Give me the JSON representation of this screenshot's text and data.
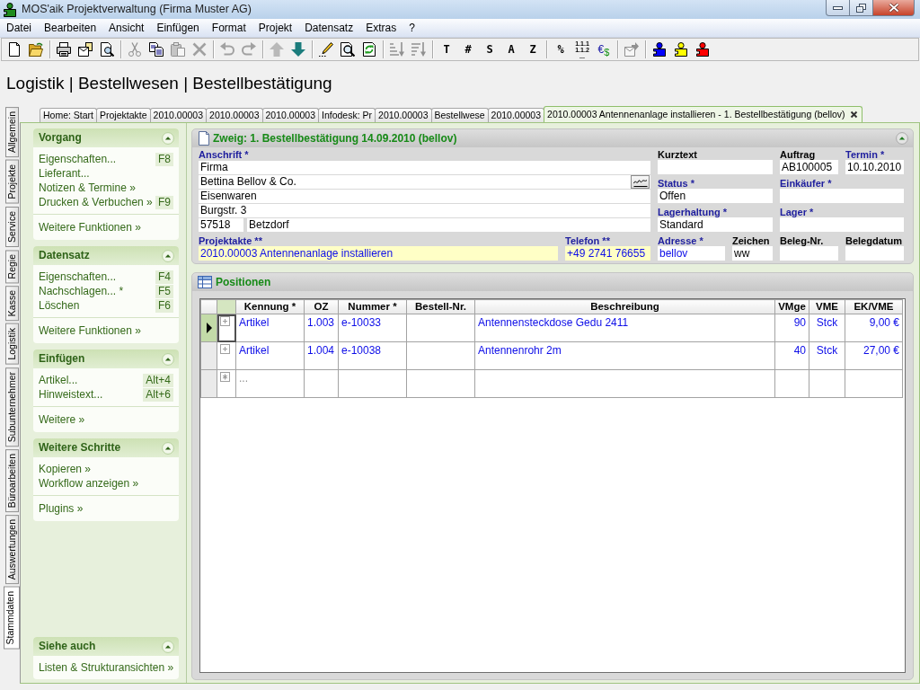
{
  "window": {
    "title": "MOS'aik Projektverwaltung (Firma Muster AG)"
  },
  "menu": [
    "Datei",
    "Bearbeiten",
    "Ansicht",
    "Einfügen",
    "Format",
    "Projekt",
    "Datensatz",
    "Extras",
    "?"
  ],
  "toolbar": [
    [
      {
        "kind": "icon",
        "disabled": false
      },
      {
        "kind": "icon",
        "disabled": false
      }
    ],
    [
      {
        "kind": "icon",
        "disabled": false
      },
      {
        "kind": "icon",
        "disabled": false
      },
      {
        "kind": "icon",
        "disabled": false
      }
    ],
    [
      {
        "kind": "icon",
        "disabled": true
      },
      {
        "kind": "icon",
        "disabled": false
      },
      {
        "kind": "icon",
        "disabled": true
      },
      {
        "kind": "icon",
        "disabled": true
      }
    ],
    [
      {
        "kind": "icon",
        "disabled": true
      },
      {
        "kind": "icon",
        "disabled": true
      }
    ],
    [
      {
        "kind": "icon",
        "disabled": true
      },
      {
        "kind": "icon",
        "disabled": false
      }
    ],
    [
      {
        "kind": "icon",
        "disabled": false
      },
      {
        "kind": "icon",
        "disabled": false
      },
      {
        "kind": "icon",
        "disabled": false
      }
    ],
    [
      {
        "kind": "icon",
        "disabled": true
      },
      {
        "kind": "icon",
        "disabled": true
      }
    ],
    [
      {
        "kind": "text",
        "label": "T"
      },
      {
        "kind": "text",
        "label": "#"
      },
      {
        "kind": "text",
        "label": "S"
      },
      {
        "kind": "text",
        "label": "A"
      },
      {
        "kind": "text",
        "label": "Z"
      }
    ],
    [
      {
        "kind": "text",
        "label": "%"
      },
      {
        "kind": "outline",
        "lines": [
          "1.1.1",
          "1.1.2",
          "..."
        ]
      },
      {
        "kind": "currency",
        "label": "€",
        "suffix": "$"
      }
    ],
    [
      {
        "kind": "icon",
        "disabled": true
      }
    ],
    [
      {
        "kind": "puzzle",
        "color": "#0000ff"
      },
      {
        "kind": "puzzle",
        "color": "#ffff00"
      },
      {
        "kind": "puzzle",
        "color": "#ff0000"
      }
    ]
  ],
  "page_title": "Logistik | Bestellwesen | Bestellbestätigung",
  "document_tabs": [
    {
      "label": "Home: Start",
      "selected": false
    },
    {
      "label": "Projektakte",
      "selected": false
    },
    {
      "label": "2010.00003",
      "selected": false
    },
    {
      "label": "2010.00003",
      "selected": false
    },
    {
      "label": "2010.00003",
      "selected": false
    },
    {
      "label": "Infodesk: Pr",
      "selected": false
    },
    {
      "label": "2010.00003",
      "selected": false
    },
    {
      "label": "Bestellwese",
      "selected": false
    },
    {
      "label": "2010.00003",
      "selected": false
    },
    {
      "label": "2010.00003 Antennenanlage installieren - 1. Bestellbestätigung (bellov)",
      "selected": true
    }
  ],
  "side_tabs": [
    {
      "label": "Allgemein",
      "selected": false
    },
    {
      "label": "Projekte",
      "selected": false
    },
    {
      "label": "Service",
      "selected": false
    },
    {
      "label": "Regie",
      "selected": false
    },
    {
      "label": "Kasse",
      "selected": false
    },
    {
      "label": "Logistik",
      "selected": false
    },
    {
      "label": "Subunternehmer",
      "selected": false
    },
    {
      "label": "Büroarbeiten",
      "selected": false
    },
    {
      "label": "Auswertungen",
      "selected": false
    },
    {
      "label": "Stammdaten",
      "selected": true
    }
  ],
  "sidebar": {
    "sections": [
      {
        "title": "Vorgang",
        "expanded": true,
        "items": [
          {
            "label": "Eigenschaften...",
            "shortcut": "F8"
          },
          {
            "label": "Lieferant..."
          },
          {
            "label": "Notizen & Termine »"
          },
          {
            "label": "Drucken & Verbuchen »",
            "shortcut": "F9"
          }
        ],
        "footer": "Weitere Funktionen »"
      },
      {
        "title": "Datensatz",
        "expanded": true,
        "items": [
          {
            "label": "Eigenschaften...",
            "shortcut": "F4"
          },
          {
            "label": "Nachschlagen... *",
            "shortcut": "F5"
          },
          {
            "label": "Löschen",
            "shortcut": "F6"
          }
        ],
        "footer": "Weitere Funktionen »"
      },
      {
        "title": "Einfügen",
        "expanded": true,
        "items": [
          {
            "label": "Artikel...",
            "shortcut": "Alt+4"
          },
          {
            "label": "Hinweistext...",
            "shortcut": "Alt+6"
          }
        ],
        "footer": "Weitere »"
      },
      {
        "title": "Weitere Schritte",
        "expanded": true,
        "items": [
          {
            "label": "Kopieren »"
          },
          {
            "label": "Workflow anzeigen »"
          }
        ],
        "footer": "Plugins »"
      }
    ],
    "bottom_section": {
      "title": "Siehe auch",
      "expanded": true,
      "items": [
        {
          "label": "Listen & Strukturansichten »"
        }
      ]
    }
  },
  "branch_panel": {
    "title": "Zweig: 1. Bestellbestätigung 14.09.2010 (bellov)",
    "expanded": true,
    "address": {
      "label": "Anschrift *",
      "required": true,
      "lines": [
        {
          "value": "Firma",
          "lookup": false
        },
        {
          "value": "Bettina Bellov & Co.",
          "lookup": true
        },
        {
          "value": "Eisenwaren",
          "lookup": false
        },
        {
          "value": "Burgstr. 3",
          "lookup": false
        }
      ],
      "zip": "57518",
      "city": "Betzdorf"
    },
    "fields": [
      {
        "label": "Kurztext",
        "required": false,
        "highlighted": false
      },
      {
        "label": "Auftrag",
        "required": false,
        "value": "AB100005",
        "highlighted": false,
        "linked": false
      },
      {
        "label": "Termin *",
        "required": true,
        "value": "10.10.2010",
        "highlighted": false,
        "linked": false
      },
      {
        "label": "Status *",
        "required": true,
        "value": "Offen",
        "highlighted": false,
        "linked": false
      },
      {
        "label": "Einkäufer *",
        "required": true,
        "highlighted": false
      },
      {
        "label": "Lagerhaltung *",
        "required": true,
        "value": "Standard",
        "highlighted": false,
        "linked": false
      },
      {
        "label": "Lager *",
        "required": true,
        "highlighted": false
      },
      {
        "label": "Projektakte **",
        "required": true,
        "value": "2010.00003 Antennenanlage installieren",
        "highlighted": true,
        "linked": true
      },
      {
        "label": "Telefon **",
        "required": true,
        "value": "+49 2741 76655",
        "highlighted": true,
        "linked": true
      },
      {
        "label": "Adresse *",
        "required": true,
        "value": "bellov",
        "highlighted": false,
        "linked": true
      },
      {
        "label": "Zeichen",
        "required": false,
        "value": "ww",
        "highlighted": false,
        "linked": false
      },
      {
        "label": "Beleg-Nr.",
        "required": false,
        "highlighted": false
      },
      {
        "label": "Belegdatum",
        "required": false,
        "highlighted": false
      }
    ]
  },
  "positions_panel": {
    "title": "Positionen",
    "columns": [
      "Kennung *",
      "OZ",
      "Nummer *",
      "Bestell-Nr.",
      "Beschreibung",
      "VMge",
      "VME",
      "EK/VME"
    ],
    "rows": [
      {
        "kind": "item",
        "selected": true,
        "expanded": false,
        "cells": [
          "Artikel",
          "1.003",
          "e-10033",
          null,
          "Antennensteckdose Gedu 2411",
          "90",
          "Stck",
          "9,00 €"
        ]
      },
      {
        "kind": "item",
        "selected": false,
        "expanded": false,
        "cells": [
          "Artikel",
          "1.004",
          "e-10038",
          null,
          "Antennenrohr 2m",
          "40",
          "Stck",
          "27,00 €"
        ]
      },
      {
        "kind": "new",
        "selected": false,
        "cells": [
          "...",
          null,
          null,
          null,
          null,
          null,
          null,
          null
        ]
      }
    ]
  }
}
